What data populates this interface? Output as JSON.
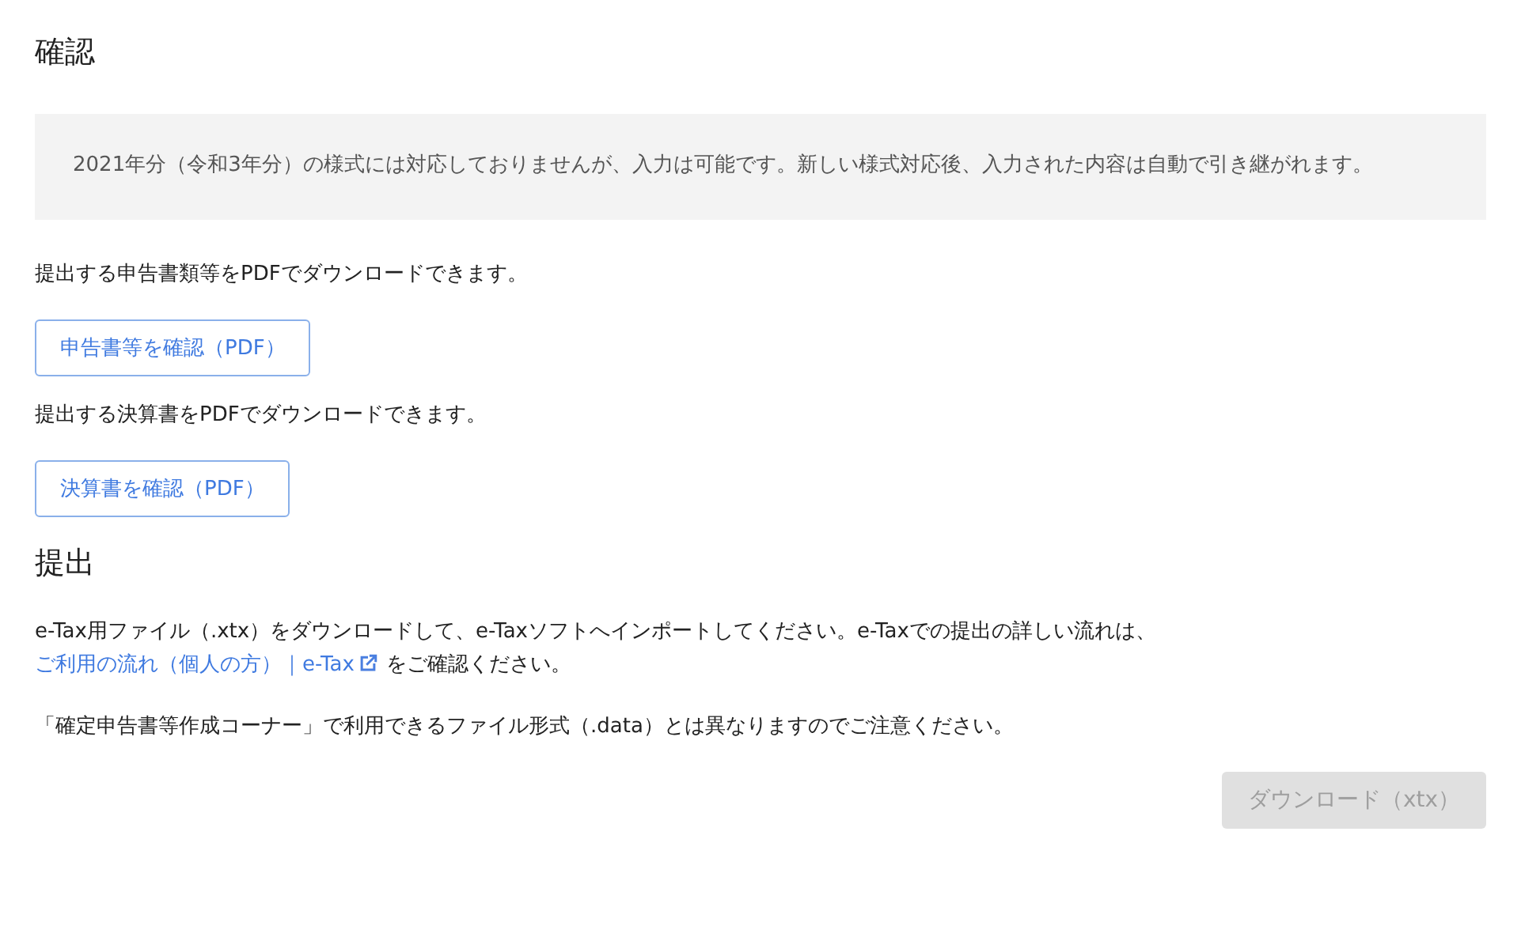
{
  "confirm_section": {
    "heading": "確認",
    "notice": "2021年分（令和3年分）の様式には対応しておりませんが、入力は可能です。新しい様式対応後、入力された内容は自動で引き継がれます。",
    "items": [
      {
        "description": "提出する申告書類等をPDFでダウンロードできます。",
        "button": "申告書等を確認（PDF）"
      },
      {
        "description": "提出する決算書をPDFでダウンロードできます。",
        "button": "決算書を確認（PDF）"
      }
    ]
  },
  "submit_section": {
    "heading": "提出",
    "instruction": {
      "text_before": "e-Tax用ファイル（.xtx）をダウンロードして、e-Taxソフトへインポートしてください。e-Taxでの提出の詳しい流れは、",
      "link": "ご利用の流れ（個人の方）｜e-Tax",
      "text_after": "をご確認ください。"
    },
    "caution": "「確定申告書等作成コーナー」で利用できるファイル形式（.data）とは異なりますのでご注意ください。",
    "download_button": {
      "label": "ダウンロード（xtx）",
      "disabled": true
    }
  }
}
